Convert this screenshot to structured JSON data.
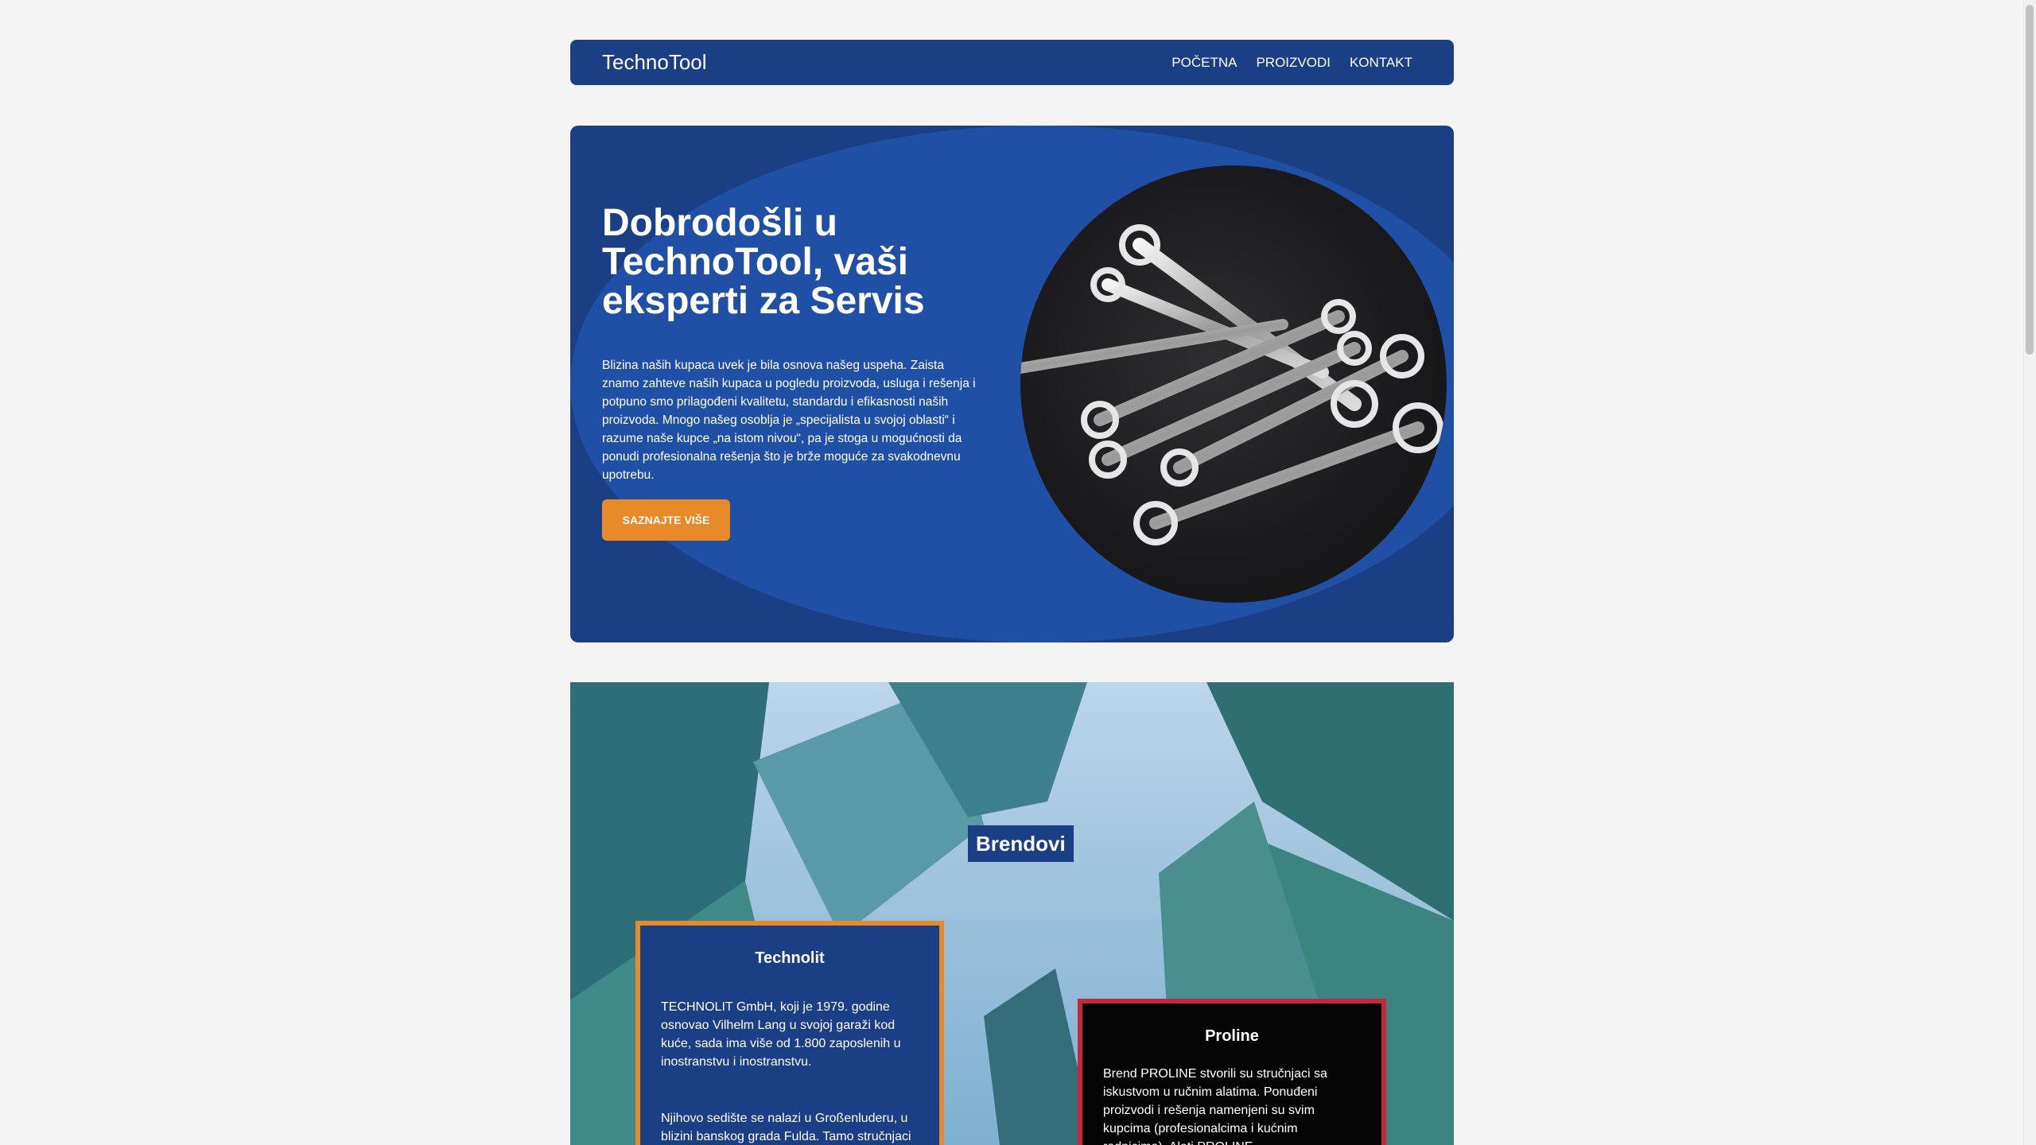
{
  "nav": {
    "brand": "TechnoTool",
    "links": [
      "POČETNA",
      "PROIZVODI",
      "KONTAKT"
    ]
  },
  "hero": {
    "title": "Dobrodošli u TechnoTool, vaši eksperti za Servis",
    "text": "Blizina naših kupaca uvek je bila osnova našeg uspeha. Zaista znamo zahteve naših kupaca u pogledu proizvoda, usluga i rešenja i potpuno smo prilagođeni kvalitetu, standardu i efikasnosti naših proizvoda. Mnogo našeg osoblja je „specijalista u svojoj oblasti“ i razume naše kupce „na istom nivou“, pa je stoga u mogućnosti da ponudi profesionalna rešenja što je brže moguće za svakodnevnu upotrebu.",
    "button": "SAZNAJTE VIŠE",
    "image_icon": "wrench-set-icon"
  },
  "brands": {
    "title": "Brendovi",
    "technolit": {
      "title": "Technolit",
      "text": "TECHNOLIT GmbH, koji je 1979. godine osnovao Vilhelm Lang u svojoj garaži kod kuće, sada ima više od 1.800 zaposlenih u inostranstvu i inostranstvu.",
      "text2": "Njihovo sedište se nalazi u Großenluderu, u blizini banskog grada Fulda. Tamo stručnjaci"
    },
    "proline": {
      "title": "Proline",
      "text": "Brend PROLINE stvorili su stručnjaci sa iskustvom u ručnim alatima. Ponuđeni proizvodi i rešenja namenjeni su svim kupcima (profesionalcima i kućnim radnicima). Alati PROLINE"
    }
  },
  "colors": {
    "navy": "#1a3f85",
    "blue": "#2050a6",
    "orange": "#e8892a",
    "red": "#c6283a"
  }
}
